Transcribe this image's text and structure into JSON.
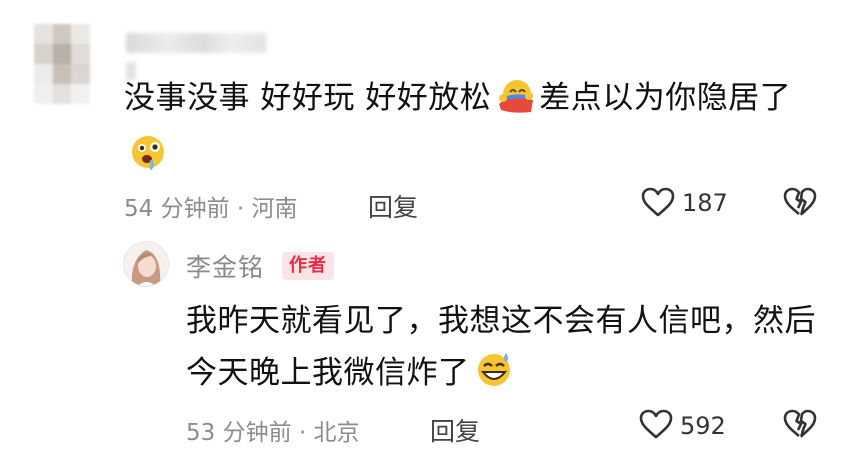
{
  "comment": {
    "text_part1": "没事没事 好好玩 好好放松",
    "text_part2": "差点以为你隐居了",
    "emoji_1": "hug-face-emoji",
    "emoji_2": "drooling-face-emoji",
    "time": "54 分钟前",
    "separator": "·",
    "location": "河南",
    "reply_label": "回复",
    "like_count": "187"
  },
  "author_reply": {
    "author_name": "李金铭",
    "badge": "作者",
    "text": "我昨天就看见了，我想这不会有人信吧，然后今天晚上我微信炸了",
    "emoji": "laughing-sweat-emoji",
    "time": "53 分钟前",
    "separator": "·",
    "location": "北京",
    "reply_label": "回复",
    "like_count": "592"
  },
  "colors": {
    "badge_bg": "#fbe4e6",
    "badge_text": "#ee2b47",
    "meta_text": "#8c8c8c",
    "body_text": "#111111"
  }
}
